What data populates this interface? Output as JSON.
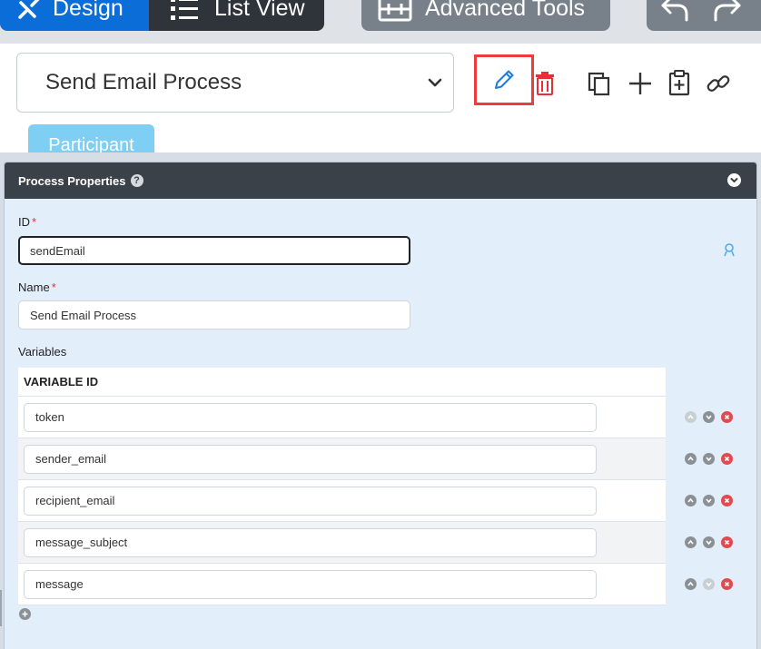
{
  "toolbar": {
    "design_label": "Design",
    "list_view_label": "List View",
    "advanced_tools_label": "Advanced Tools",
    "icons": [
      "design-icon",
      "list-icon",
      "advanced-tools-icon",
      "undo-icon",
      "redo-icon"
    ]
  },
  "process_selector": {
    "value": "Send Email Process"
  },
  "actions": [
    "edit-pencil-icon",
    "trash-icon",
    "copy-icon",
    "plus-icon",
    "paste-icon",
    "link-icon"
  ],
  "participant_label": "Participant",
  "panel": {
    "title": "Process Properties",
    "help_glyph": "?",
    "id_label": "ID",
    "id_value": "sendEmail",
    "name_label": "Name",
    "name_value": "Send Email Process",
    "required_marker": "*",
    "variables_label": "Variables",
    "variables_column_header": "VARIABLE ID",
    "variables": [
      {
        "id": "token",
        "up_enabled": false,
        "down_enabled": true
      },
      {
        "id": "sender_email",
        "up_enabled": true,
        "down_enabled": true
      },
      {
        "id": "recipient_email",
        "up_enabled": true,
        "down_enabled": true
      },
      {
        "id": "message_subject",
        "up_enabled": true,
        "down_enabled": true
      },
      {
        "id": "message",
        "up_enabled": true,
        "down_enabled": false
      }
    ]
  },
  "colors": {
    "design_active": "#0a6dd8",
    "toolbar_dark": "#2e3439",
    "toolbar_grey": "#788089",
    "edit_icon_blue": "#1b7ce0",
    "highlight_red": "#ef3b3b",
    "delete_red": "#e5303a",
    "participant_blue": "#7fcff4",
    "panel_header": "#3a4149",
    "panel_body": "#e3eefb"
  }
}
